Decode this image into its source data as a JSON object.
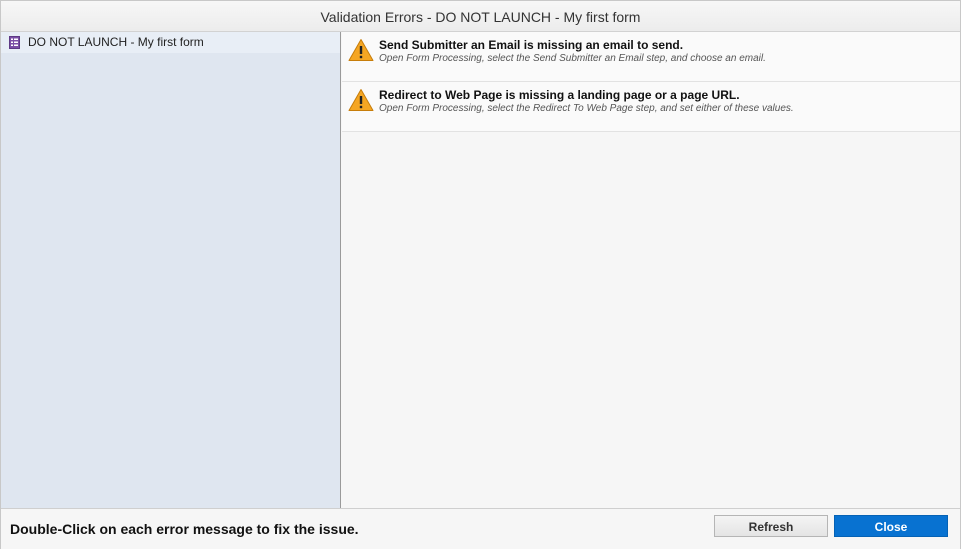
{
  "window": {
    "title": "Validation Errors - DO NOT LAUNCH - My first form"
  },
  "tree": {
    "items": [
      {
        "label": "DO NOT LAUNCH - My first form",
        "icon": "form-icon",
        "selected": true
      }
    ]
  },
  "errors": [
    {
      "icon": "warning-icon",
      "title": "Send Submitter an Email is missing an email to send.",
      "detail": "Open Form Processing, select the Send Submitter an Email step, and choose an email."
    },
    {
      "icon": "warning-icon",
      "title": "Redirect to Web Page is missing a landing page or a page URL.",
      "detail": "Open Form Processing, select the Redirect To Web Page step, and set either of these values."
    }
  ],
  "footer": {
    "hint": "Double-Click on each error message to fix the issue.",
    "refresh_label": "Refresh",
    "close_label": "Close"
  },
  "colors": {
    "accent": "#0872d1",
    "warning": "#f5a623",
    "form_icon": "#7b4fa6"
  }
}
